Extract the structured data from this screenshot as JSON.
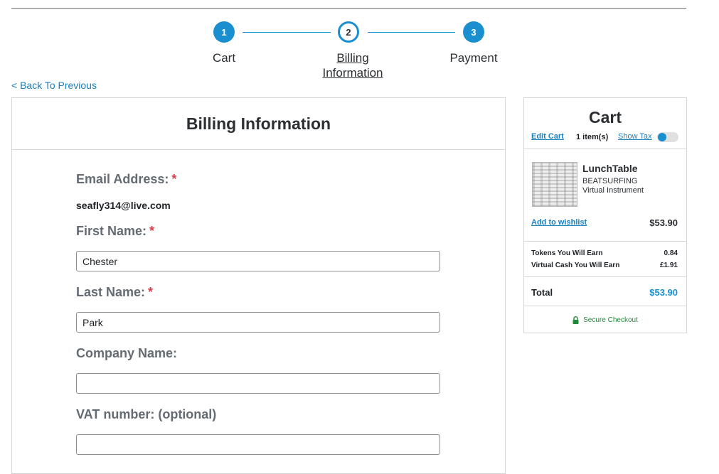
{
  "stepper": {
    "steps": [
      {
        "number": "1",
        "label": "Cart"
      },
      {
        "number": "2",
        "label_line1": "Billing",
        "label_line2": "Information"
      },
      {
        "number": "3",
        "label": "Payment"
      }
    ],
    "accent_color": "#1a8fd0"
  },
  "nav": {
    "back_label": "< Back To Previous"
  },
  "billing": {
    "title": "Billing Information",
    "required_mark": "*",
    "email_label": "Email Address:",
    "email_value": "seafly314@live.com",
    "first_name_label": "First Name:",
    "first_name_value": "Chester",
    "last_name_label": "Last Name:",
    "last_name_value": "Park",
    "company_label": "Company Name:",
    "company_value": "",
    "vat_label": "VAT number: (optional)",
    "vat_value": ""
  },
  "cart": {
    "title": "Cart",
    "edit_label": "Edit Cart",
    "items_count": "1 item(s)",
    "show_tax_label": "Show Tax",
    "show_tax_on": false,
    "item": {
      "name": "LunchTable",
      "brand": "BEATSURFING",
      "type": "Virtual Instrument",
      "price": "$53.90",
      "wishlist_label": "Add to wishlist"
    },
    "tokens_label": "Tokens You Will Earn",
    "tokens_value": "0.84",
    "virtual_cash_label": "Virtual Cash You Will Earn",
    "virtual_cash_value": "£1.91",
    "total_label": "Total",
    "total_value": "$53.90",
    "secure_label": "Secure Checkout",
    "secure_color": "#1f8a3a"
  }
}
